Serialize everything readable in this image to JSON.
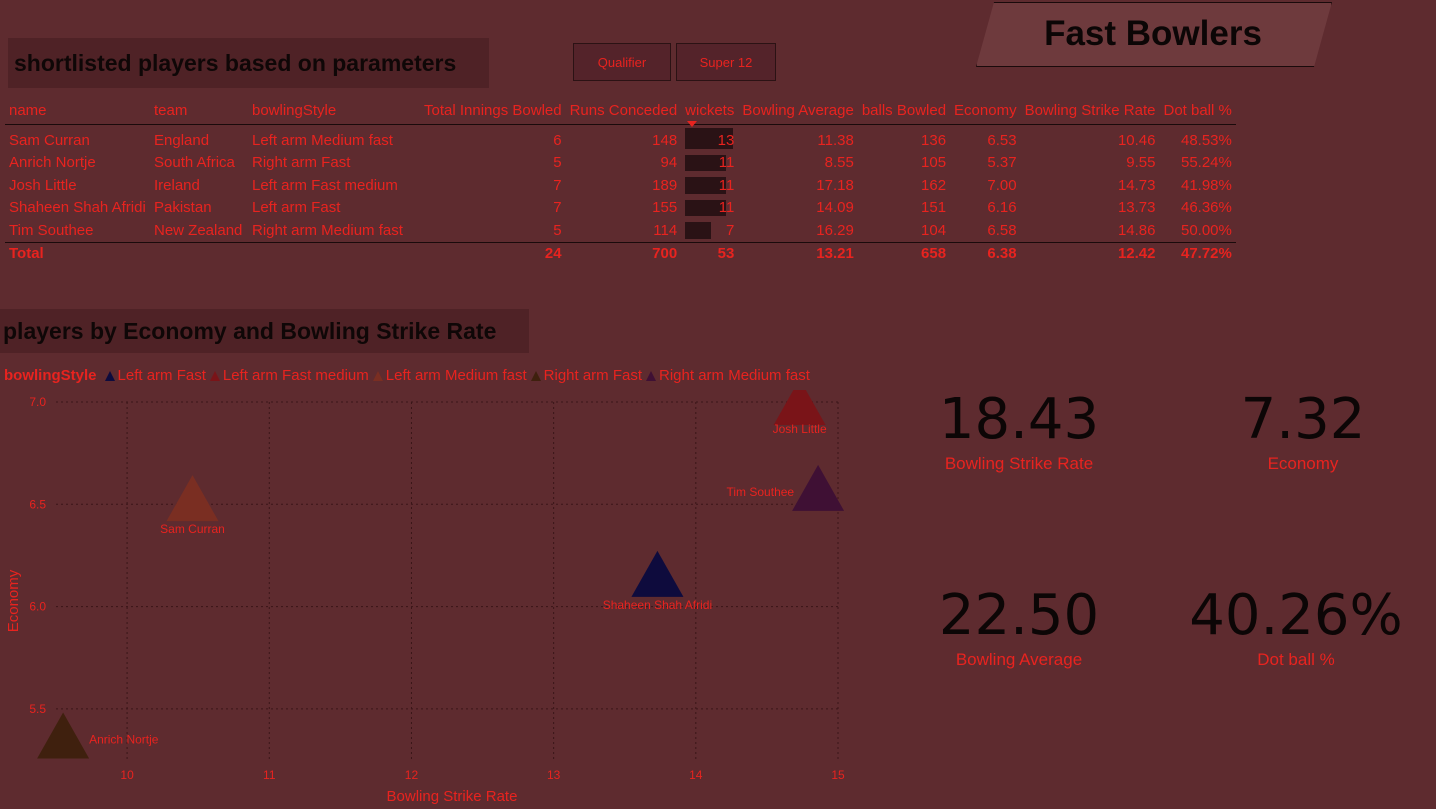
{
  "page_title": "Fast Bowlers",
  "table_section": {
    "title": "shortlisted players based on parameters"
  },
  "slicer": {
    "buttons": [
      "Qualifier",
      "Super 12"
    ]
  },
  "table": {
    "headers": [
      "name",
      "team",
      "bowlingStyle",
      "Total Innings Bowled",
      "Runs Conceded",
      "wickets",
      "Bowling Average",
      "balls Bowled",
      "Economy",
      "Bowling Strike Rate",
      "Dot ball %"
    ],
    "rows": [
      [
        "Sam Curran",
        "England",
        "Left arm Medium fast",
        "6",
        "148",
        "13",
        "11.38",
        "136",
        "6.53",
        "10.46",
        "48.53%"
      ],
      [
        "Anrich Nortje",
        "South Africa",
        "Right arm Fast",
        "5",
        "94",
        "11",
        "8.55",
        "105",
        "5.37",
        "9.55",
        "55.24%"
      ],
      [
        "Josh Little",
        "Ireland",
        "Left arm Fast medium",
        "7",
        "189",
        "11",
        "17.18",
        "162",
        "7.00",
        "14.73",
        "41.98%"
      ],
      [
        "Shaheen Shah Afridi",
        "Pakistan",
        "Left arm Fast",
        "7",
        "155",
        "11",
        "14.09",
        "151",
        "6.16",
        "13.73",
        "46.36%"
      ],
      [
        "Tim Southee",
        "New Zealand",
        "Right arm Medium fast",
        "5",
        "114",
        "7",
        "16.29",
        "104",
        "6.58",
        "14.86",
        "50.00%"
      ]
    ],
    "wickets_max": 13,
    "total": {
      "label": "Total",
      "innings": "24",
      "runs": "700",
      "wickets": "53",
      "average": "13.21",
      "balls": "658",
      "economy": "6.38",
      "strike_rate": "12.42",
      "dot_pct": "47.72%"
    }
  },
  "chart_section": {
    "title": "players by Economy and Bowling Strike Rate"
  },
  "legend": {
    "title": "bowlingStyle",
    "items": [
      {
        "label": "Left arm Fast",
        "color": "#0e0b3d"
      },
      {
        "label": "Left arm Fast medium",
        "color": "#7a1418"
      },
      {
        "label": "Left arm Medium fast",
        "color": "#7a2e22"
      },
      {
        "label": "Right arm Fast",
        "color": "#3f200e"
      },
      {
        "label": "Right arm Medium fast",
        "color": "#3f1034"
      }
    ]
  },
  "chart_data": {
    "type": "scatter",
    "xlabel": "Bowling Strike Rate",
    "ylabel": "Economy",
    "xlim": [
      9.5,
      15
    ],
    "ylim": [
      5.25,
      7.0
    ],
    "xticks": [
      10,
      11,
      12,
      13,
      14,
      15
    ],
    "yticks": [
      5.5,
      6.0,
      6.5,
      7.0
    ],
    "ytick_labels": [
      "5.5",
      "6.0",
      "6.5",
      "7.0"
    ],
    "grid": true,
    "points": [
      {
        "name": "Sam Curran",
        "x": 10.46,
        "y": 6.53,
        "style": "Left arm Medium fast"
      },
      {
        "name": "Anrich Nortje",
        "x": 9.55,
        "y": 5.37,
        "style": "Right arm Fast"
      },
      {
        "name": "Josh Little",
        "x": 14.73,
        "y": 7.0,
        "style": "Left arm Fast medium"
      },
      {
        "name": "Shaheen Shah Afridi",
        "x": 13.73,
        "y": 6.16,
        "style": "Left arm Fast"
      },
      {
        "name": "Tim Southee",
        "x": 14.86,
        "y": 6.58,
        "style": "Right arm Medium fast"
      }
    ]
  },
  "kpis": [
    {
      "value": "18.43",
      "label": "Bowling Strike Rate"
    },
    {
      "value": "7.32",
      "label": "Economy"
    },
    {
      "value": "22.50",
      "label": "Bowling Average"
    },
    {
      "value": "40.26%",
      "label": "Dot ball %"
    }
  ]
}
